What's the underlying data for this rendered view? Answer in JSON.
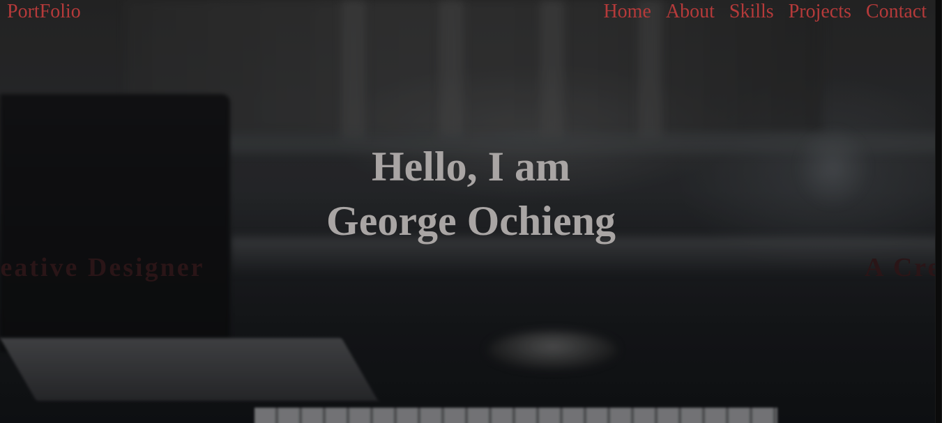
{
  "nav": {
    "logo": "PortFolio",
    "links": [
      "Home",
      "About",
      "Skills",
      "Projects",
      "Contact"
    ]
  },
  "hero": {
    "line1": "Hello, I am",
    "line2": "George Ochieng",
    "tagline_left": "A Creative Designer",
    "tagline_right": "A Creative Designer"
  },
  "colors": {
    "nav_text": "#b53a3a",
    "hero_text": "#a9a5a4",
    "tagline_text": "#2a1517"
  }
}
